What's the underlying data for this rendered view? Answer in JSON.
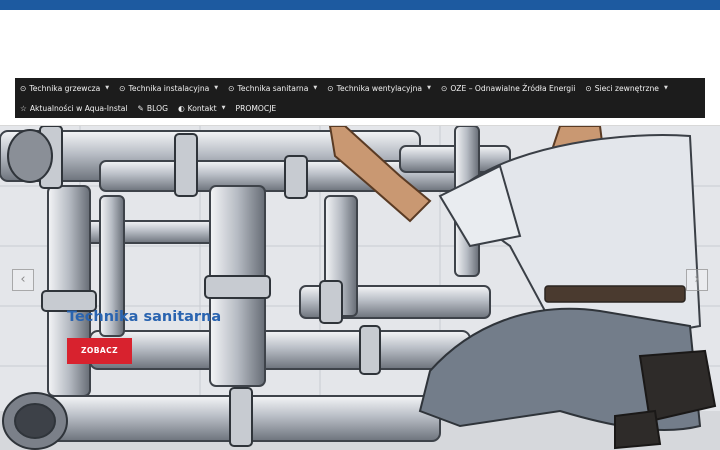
{
  "colors": {
    "top_bar": "#1d5aa0",
    "nav_background": "#1c1c1c",
    "nav_text": "#f2f2f2",
    "slide_title": "#2a64b0",
    "cta_background": "#d8222e"
  },
  "nav": {
    "row1": [
      {
        "label": "Technika grzewcza",
        "icon": "circle-dot-icon",
        "icon_glyph": "⊙",
        "has_dropdown": true
      },
      {
        "label": "Technika instalacyjna",
        "icon": "circle-dot-icon",
        "icon_glyph": "⊙",
        "has_dropdown": true
      },
      {
        "label": "Technika sanitarna",
        "icon": "circle-dot-icon",
        "icon_glyph": "⊙",
        "has_dropdown": true
      },
      {
        "label": "Technika wentylacyjna",
        "icon": "circle-dot-icon",
        "icon_glyph": "⊙",
        "has_dropdown": true
      },
      {
        "label": "OZE – Odnawialne Źródła Energii",
        "icon": "circle-dot-icon",
        "icon_glyph": "⊙",
        "has_dropdown": false
      },
      {
        "label": "Sieci zewnętrzne",
        "icon": "circle-dot-icon",
        "icon_glyph": "⊙",
        "has_dropdown": true
      }
    ],
    "row2": [
      {
        "label": "Aktualności w Aqua-Instal",
        "icon": "star-icon",
        "icon_glyph": "☆",
        "has_dropdown": false
      },
      {
        "label": "BLOG",
        "icon": "pen-icon",
        "icon_glyph": "✎",
        "has_dropdown": false
      },
      {
        "label": "Kontakt",
        "icon": "contrast-icon",
        "icon_glyph": "◐",
        "has_dropdown": true
      },
      {
        "label": "PROMOCJE",
        "icon": "",
        "icon_glyph": "",
        "has_dropdown": false
      }
    ],
    "caret_glyph": "▼"
  },
  "slider": {
    "title": "Technika sanitarna",
    "button_label": "ZOBACZ",
    "prev_glyph": "‹",
    "next_glyph": "›",
    "image_alt": "illustration-worker-installing-pipes"
  }
}
